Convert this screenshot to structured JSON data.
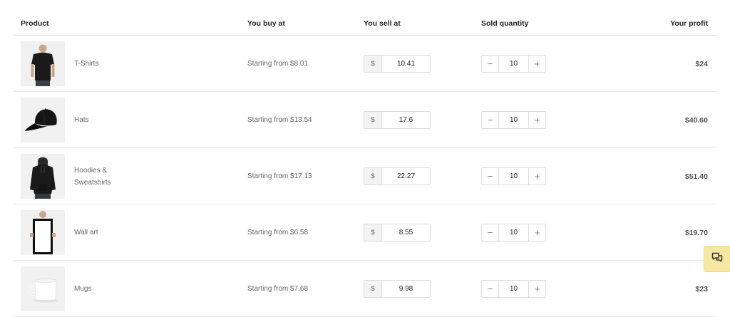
{
  "header": {
    "product": "Product",
    "buy_at": "You buy at",
    "sell_at": "You sell at",
    "sold_quantity": "Sold quantity",
    "profit": "Your profit"
  },
  "currency_symbol": "$",
  "rows": [
    {
      "name": "T-Shirts",
      "buy_at": "Starting from $8.01",
      "sell_at": "10.41",
      "quantity": "10",
      "profit": "$24",
      "image": "tshirt-image"
    },
    {
      "name": "Hats",
      "buy_at": "Starting from $13.54",
      "sell_at": "17.6",
      "quantity": "10",
      "profit": "$40.60",
      "image": "hat-image"
    },
    {
      "name": "Hoodies & Sweatshirts",
      "buy_at": "Starting from $17.13",
      "sell_at": "22.27",
      "quantity": "10",
      "profit": "$51.40",
      "image": "hoodie-image"
    },
    {
      "name": "Wall art",
      "buy_at": "Starting from $6.58",
      "sell_at": "8.55",
      "quantity": "10",
      "profit": "$19.70",
      "image": "wall-art-image"
    },
    {
      "name": "Mugs",
      "buy_at": "Starting from $7.68",
      "sell_at": "9.98",
      "quantity": "10",
      "profit": "$23",
      "image": "mug-image"
    }
  ],
  "controls": {
    "minus": "−",
    "plus": "+"
  },
  "chat_widget": {
    "icon": "chat-icon",
    "color": "#f7e7a3"
  }
}
